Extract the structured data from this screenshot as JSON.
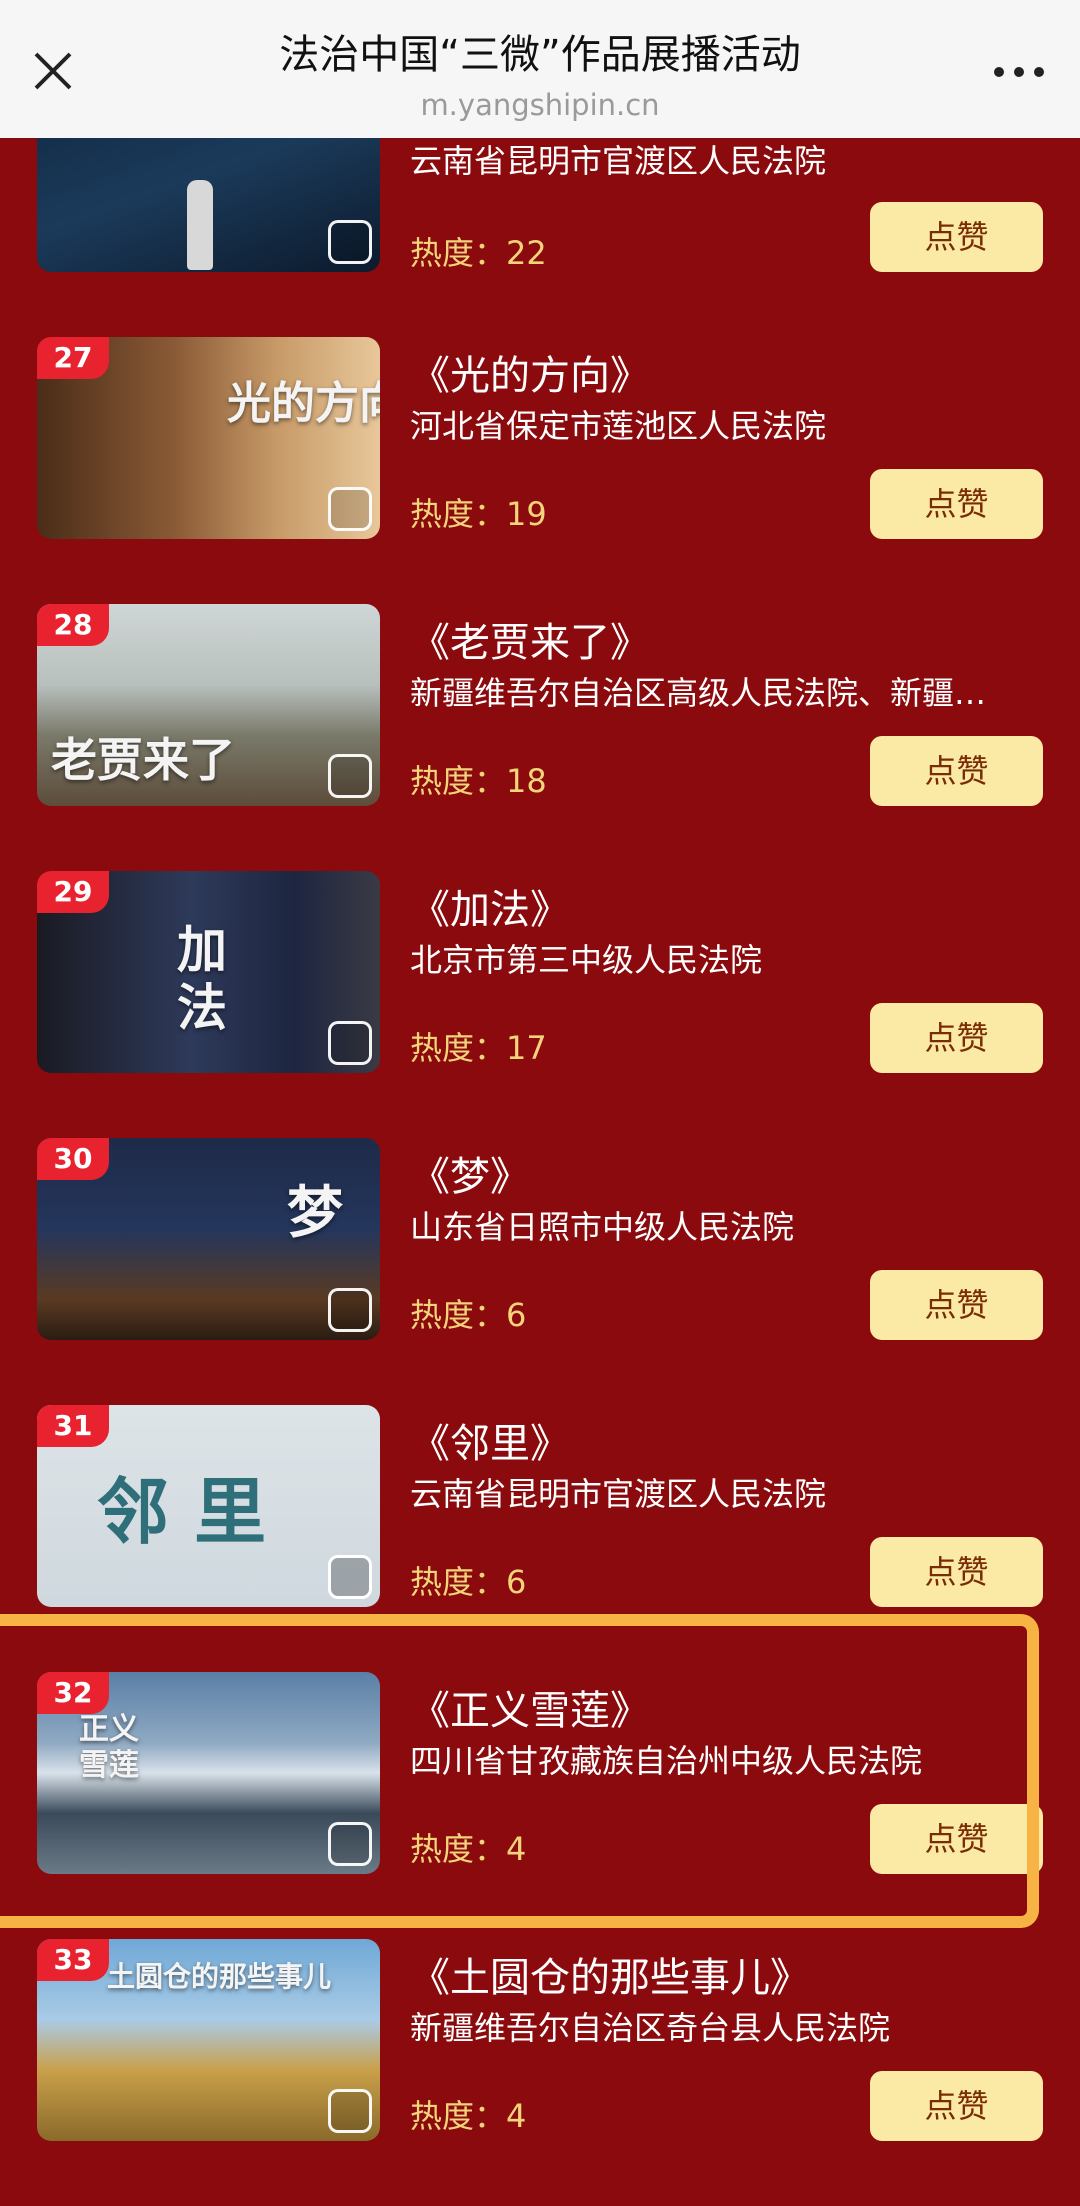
{
  "header": {
    "title": "法治中国“三微”作品展播活动",
    "url": "m.yangshipin.cn",
    "close_icon": "close-icon",
    "more_icon": "more-dots-icon"
  },
  "heat_label": "热度：",
  "like_label": "点赞",
  "items": [
    {
      "rank": "",
      "title": "",
      "court": "云南省昆明市官渡区人民法院",
      "heat": "22"
    },
    {
      "rank": "27",
      "title": "《光的方向》",
      "court": "河北省保定市莲池区人民法院",
      "heat": "19"
    },
    {
      "rank": "28",
      "title": "《老贾来了》",
      "court": "新疆维吾尔自治区高级人民法院、新疆…",
      "heat": "18"
    },
    {
      "rank": "29",
      "title": "《加法》",
      "court": "北京市第三中级人民法院",
      "heat": "17"
    },
    {
      "rank": "30",
      "title": "《梦》",
      "court": "山东省日照市中级人民法院",
      "heat": "6"
    },
    {
      "rank": "31",
      "title": "《邻里》",
      "court": "云南省昆明市官渡区人民法院",
      "heat": "6"
    },
    {
      "rank": "32",
      "title": "《正义雪莲》",
      "court": "四川省甘孜藏族自治州中级人民法院",
      "heat": "4"
    },
    {
      "rank": "33",
      "title": "《土圆仓的那些事儿》",
      "court": "新疆维吾尔自治区奇台县人民法院",
      "heat": "4"
    }
  ],
  "thumb_texts": {
    "t27": "光的方向",
    "t28": "老贾来了",
    "t29": "加法",
    "t30": "梦",
    "t31": "邻 里",
    "t32": "正义雪莲",
    "t33": "土圆仓的那些事儿"
  },
  "colors": {
    "background": "#8b0a0d",
    "rank_badge": "#e8232f",
    "like_button": "#fbeaa6",
    "heat_text": "#f3d47a",
    "highlight_border": "#f7b444"
  }
}
